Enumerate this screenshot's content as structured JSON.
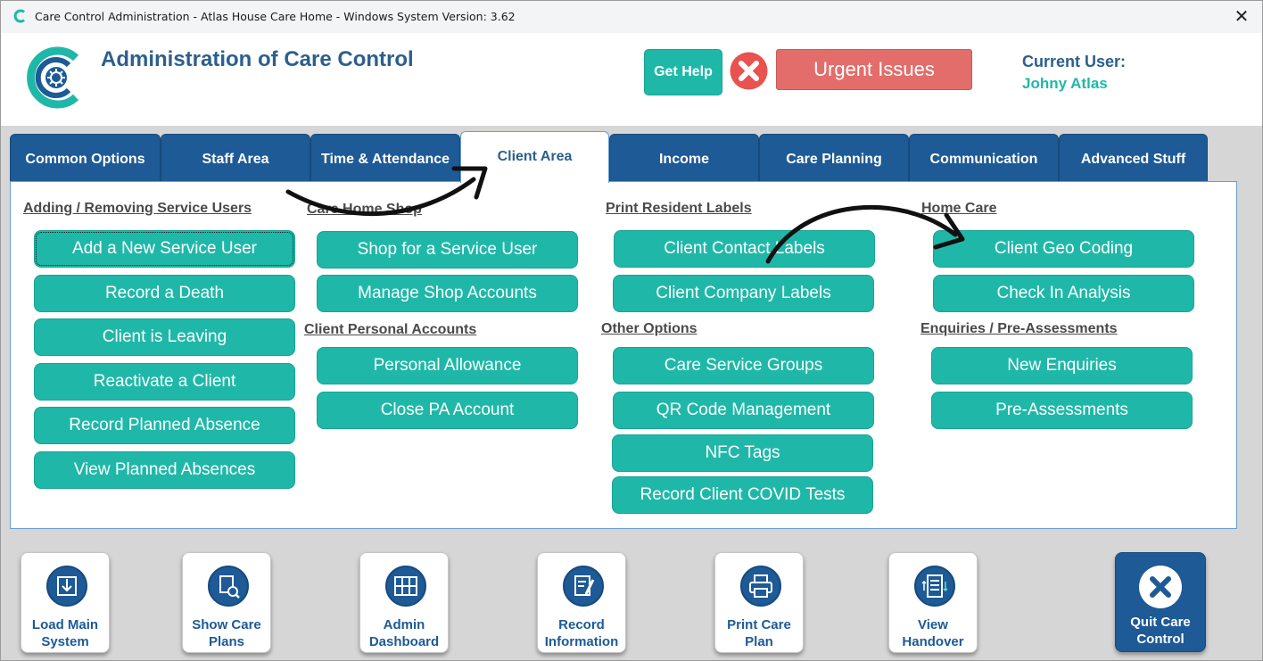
{
  "window": {
    "title": "Care Control Administration - Atlas House Care Home - Windows System Version: 3.62",
    "close_glyph": "✕"
  },
  "header": {
    "heading": "Administration of Care Control",
    "help_label": "Get Help",
    "urgent_label": "Urgent Issues",
    "user_label": "Current User:",
    "user_name": "Johny Atlas"
  },
  "tabs": [
    {
      "label": "Common Options"
    },
    {
      "label": "Staff Area"
    },
    {
      "label": "Time & Attendance"
    },
    {
      "label": "Client Area",
      "active": true
    },
    {
      "label": "Income"
    },
    {
      "label": "Care Planning"
    },
    {
      "label": "Communication"
    },
    {
      "label": "Advanced Stuff"
    }
  ],
  "sections": {
    "adding_removing": {
      "title": "Adding / Removing Service Users",
      "buttons": [
        "Add a New Service User",
        "Record a Death",
        "Client is Leaving",
        "Reactivate a Client",
        "Record Planned Absence",
        "View Planned Absences"
      ]
    },
    "care_home_shop": {
      "title": "Care Home Shop",
      "buttons": [
        "Shop for a Service User",
        "Manage Shop Accounts"
      ]
    },
    "client_personal_accounts": {
      "title": "Client Personal Accounts",
      "buttons": [
        "Personal Allowance",
        "Close PA Account"
      ]
    },
    "print_resident_labels": {
      "title": "Print Resident Labels",
      "buttons": [
        "Client Contact Labels",
        "Client Company Labels"
      ]
    },
    "other_options": {
      "title": "Other Options",
      "buttons": [
        "Care Service Groups",
        "QR Code Management",
        "NFC Tags",
        "Record Client COVID Tests"
      ]
    },
    "home_care": {
      "title": "Home Care",
      "buttons": [
        "Client Geo Coding",
        "Check In Analysis"
      ]
    },
    "enquiries": {
      "title": "Enquiries / Pre-Assessments",
      "buttons": [
        "New Enquiries",
        "Pre-Assessments"
      ]
    }
  },
  "toolbar": {
    "load_main": {
      "line1": "Load Main",
      "line2": "System",
      "icon": "download-icon"
    },
    "show_care_plans": {
      "line1": "Show Care",
      "line2": "Plans",
      "icon": "document-search-icon"
    },
    "admin_dashboard": {
      "line1": "Admin",
      "line2": "Dashboard",
      "icon": "dashboard-icon"
    },
    "record_information": {
      "line1": "Record",
      "line2": "Information",
      "icon": "edit-document-icon"
    },
    "print_care_plan": {
      "line1": "Print Care",
      "line2": "Plan",
      "icon": "printer-icon"
    },
    "view_handover": {
      "line1": "View",
      "line2": "Handover",
      "icon": "handover-list-icon"
    },
    "quit": {
      "line1": "Quit Care",
      "line2": "Control",
      "icon": "close-circle-icon"
    }
  },
  "colors": {
    "teal": "#1fb8a8",
    "navy": "#1d5a96",
    "heading_blue": "#2c5f8d",
    "urgent_red": "#e36d6b",
    "x_red": "#e8524f"
  }
}
